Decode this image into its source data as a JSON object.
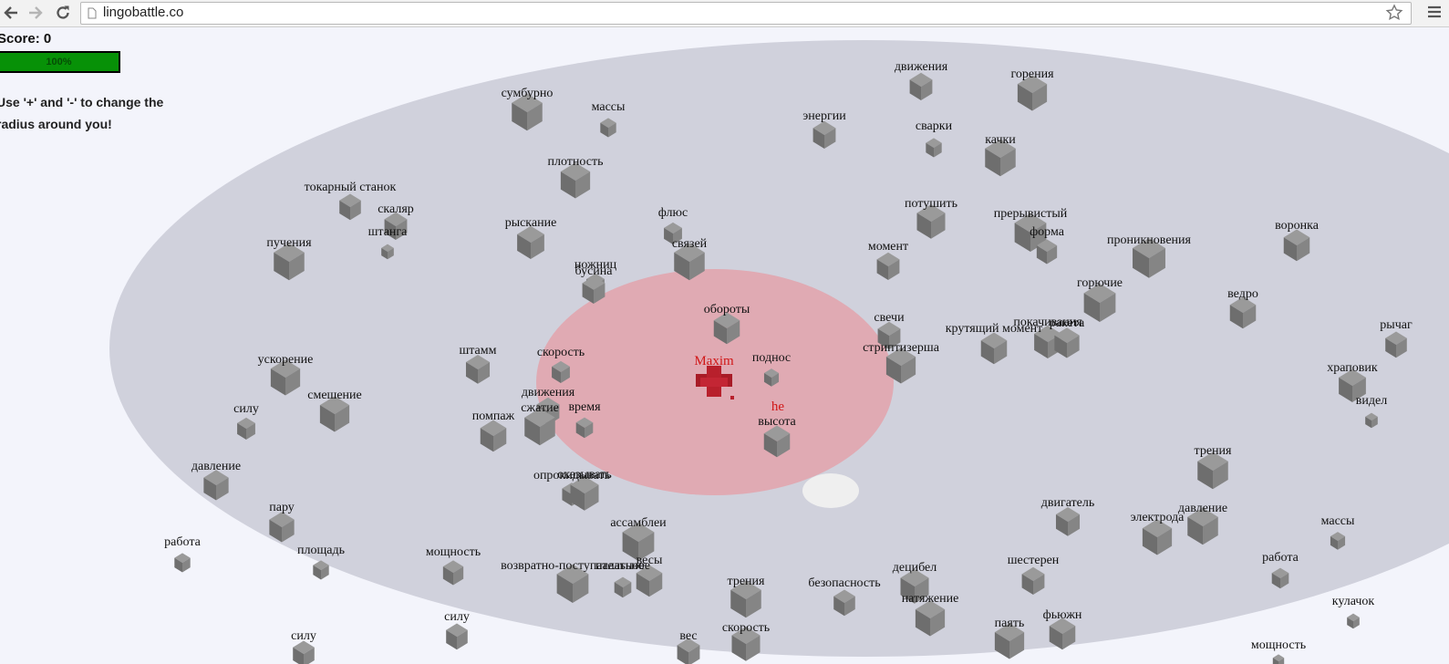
{
  "browser": {
    "url": "lingobattle.co",
    "back_icon": "back-arrow-icon",
    "forward_icon": "forward-arrow-icon",
    "reload_icon": "reload-icon",
    "star_icon": "star-icon",
    "menu_icon": "hamburger-menu-icon"
  },
  "hud": {
    "score_text": "Score: 0",
    "health_label": "100%",
    "health_value": 1.0,
    "hint": "Use '+' and '-' to change the radius around you!"
  },
  "players": [
    {
      "name": "Maxim",
      "color": "#d11818"
    },
    {
      "name": "he",
      "color": "#d11818"
    }
  ],
  "words": [
    "движения",
    "горения",
    "сумбурно",
    "массы",
    "энергии",
    "сварки",
    "качки",
    "плотность",
    "токарный станок",
    "скаляр",
    "штанга",
    "флюс",
    "потушить",
    "прерывистый",
    "форма",
    "рыскание",
    "связей",
    "пучения",
    "момент",
    "проникновения",
    "воронка",
    "ножниц",
    "бусина",
    "горючие",
    "ведро",
    "обороты",
    "свечи",
    "покачивания",
    "ракета",
    "крутящий момент",
    "рычаг",
    "ускорение",
    "штамм",
    "скорость",
    "Maxim",
    "поднос",
    "стриптизерша",
    "храповик",
    "движения",
    "смешение",
    "силу",
    "сжатие",
    "время",
    "he",
    "видел",
    "помпаж",
    "высота",
    "давление",
    "трения",
    "опрокидывать",
    "оказывать",
    "двигатель",
    "давление",
    "электрода",
    "пару",
    "ассамблеи",
    "массы",
    "работа",
    "площадь",
    "мощность",
    "весы",
    "возвратно-поступательное",
    "палатьное",
    "шестерен",
    "работа",
    "децибел",
    "трения",
    "безопасность",
    "натяжение",
    "кулачок",
    "силу",
    "паять",
    "фьюжн",
    "вес",
    "скорость",
    "мощность",
    "силу"
  ]
}
